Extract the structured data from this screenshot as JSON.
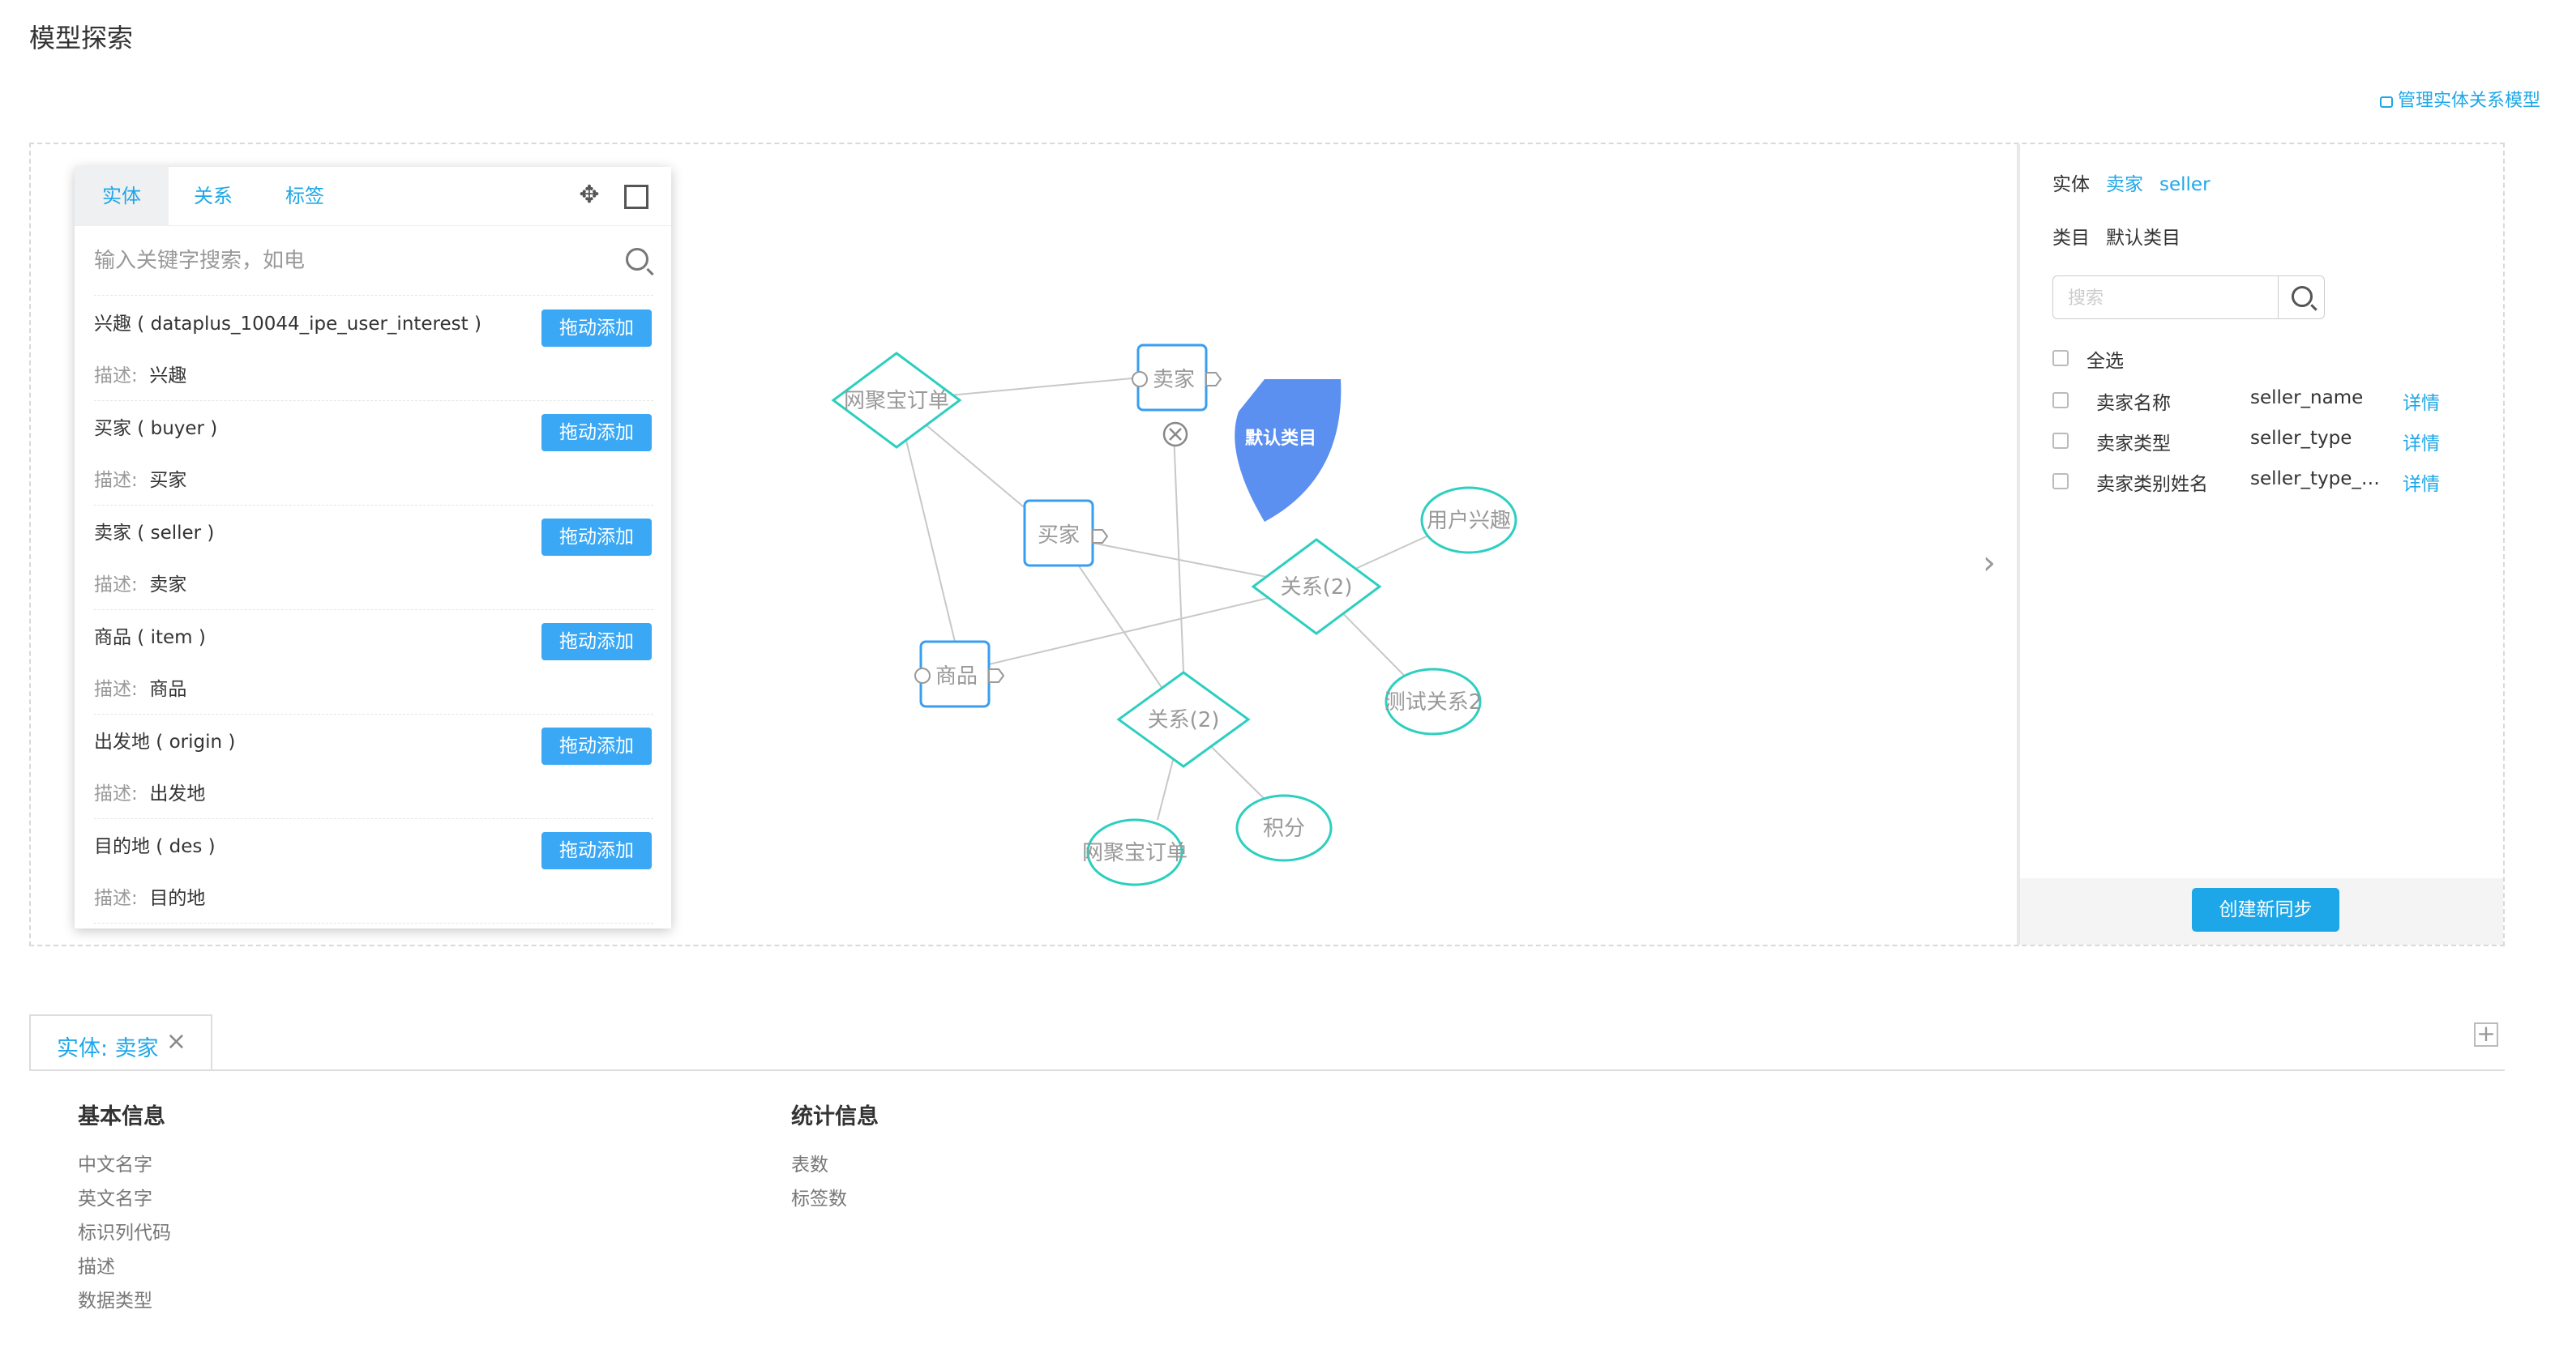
{
  "page": {
    "title": "模型探索",
    "manage_link": "管理实体关系模型"
  },
  "left_panel": {
    "tabs": [
      {
        "label": "实体"
      },
      {
        "label": "关系"
      },
      {
        "label": "标签"
      }
    ],
    "search_placeholder": "输入关键字搜索，如电",
    "desc_label": "描述:",
    "drag_label": "拖动添加",
    "entities": [
      {
        "title": "兴趣 ( dataplus_10044_ipe_user_interest )",
        "desc": "兴趣"
      },
      {
        "title": "买家 ( buyer )",
        "desc": "买家"
      },
      {
        "title": "卖家 ( seller )",
        "desc": "卖家"
      },
      {
        "title": "商品 ( item )",
        "desc": "商品"
      },
      {
        "title": "出发地 ( origin )",
        "desc": "出发地"
      },
      {
        "title": "目的地 ( des )",
        "desc": "目的地"
      }
    ]
  },
  "graph": {
    "nodes": {
      "order_top": "网聚宝订单",
      "seller": "卖家",
      "buyer": "买家",
      "item": "商品",
      "relation_right": "关系(2)",
      "relation_center": "关系(2)",
      "user_interest": "用户兴趣",
      "test_relation": "测试关系2",
      "order_bottom": "网聚宝订单",
      "points": "积分"
    },
    "popup_label": "默认类目"
  },
  "right_panel": {
    "entity_label": "实体",
    "entity_cn": "卖家",
    "entity_en": "seller",
    "category_label": "类目",
    "category_value": "默认类目",
    "search_placeholder": "搜索",
    "select_all": "全选",
    "detail_label": "详情",
    "fields": [
      {
        "cn": "卖家名称",
        "en": "seller_name"
      },
      {
        "cn": "卖家类型",
        "en": "seller_type"
      },
      {
        "cn": "卖家类别姓名",
        "en": "seller_type_n..."
      }
    ],
    "sync_button": "创建新同步"
  },
  "bottom": {
    "tab_label": "实体: 卖家",
    "basic_title": "基本信息",
    "basic_items": [
      "中文名字",
      "英文名字",
      "标识列代码",
      "描述",
      "数据类型"
    ],
    "stats_title": "统计信息",
    "stats_items": [
      "表数",
      "标签数"
    ]
  },
  "colors": {
    "accent": "#1ea7e8",
    "teal": "#2dcfbf",
    "blue_node": "#3a9ef0",
    "popup": "#5b8ff0"
  }
}
